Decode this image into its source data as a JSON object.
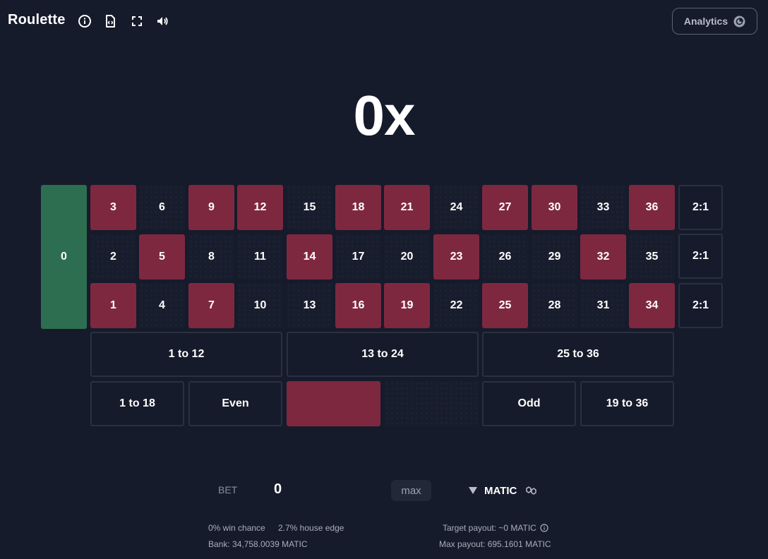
{
  "header": {
    "title": "Roulette",
    "analytics_label": "Analytics"
  },
  "colors": {
    "background": "#161b2b",
    "red": "#7e2840",
    "black": "#181d2d",
    "green": "#2d6e50"
  },
  "multiplier": "0x",
  "board": {
    "zero": "0",
    "rows": [
      [
        {
          "n": "3",
          "c": "red"
        },
        {
          "n": "6",
          "c": "black"
        },
        {
          "n": "9",
          "c": "red"
        },
        {
          "n": "12",
          "c": "red"
        },
        {
          "n": "15",
          "c": "black"
        },
        {
          "n": "18",
          "c": "red"
        },
        {
          "n": "21",
          "c": "red"
        },
        {
          "n": "24",
          "c": "black"
        },
        {
          "n": "27",
          "c": "red"
        },
        {
          "n": "30",
          "c": "red"
        },
        {
          "n": "33",
          "c": "black"
        },
        {
          "n": "36",
          "c": "red"
        }
      ],
      [
        {
          "n": "2",
          "c": "black"
        },
        {
          "n": "5",
          "c": "red"
        },
        {
          "n": "8",
          "c": "black"
        },
        {
          "n": "11",
          "c": "black"
        },
        {
          "n": "14",
          "c": "red"
        },
        {
          "n": "17",
          "c": "black"
        },
        {
          "n": "20",
          "c": "black"
        },
        {
          "n": "23",
          "c": "red"
        },
        {
          "n": "26",
          "c": "black"
        },
        {
          "n": "29",
          "c": "black"
        },
        {
          "n": "32",
          "c": "red"
        },
        {
          "n": "35",
          "c": "black"
        }
      ],
      [
        {
          "n": "1",
          "c": "red"
        },
        {
          "n": "4",
          "c": "black"
        },
        {
          "n": "7",
          "c": "red"
        },
        {
          "n": "10",
          "c": "black"
        },
        {
          "n": "13",
          "c": "black"
        },
        {
          "n": "16",
          "c": "red"
        },
        {
          "n": "19",
          "c": "red"
        },
        {
          "n": "22",
          "c": "black"
        },
        {
          "n": "25",
          "c": "red"
        },
        {
          "n": "28",
          "c": "black"
        },
        {
          "n": "31",
          "c": "black"
        },
        {
          "n": "34",
          "c": "red"
        }
      ]
    ],
    "columns": [
      "2:1",
      "2:1",
      "2:1"
    ],
    "dozens": [
      "1 to 12",
      "13 to 24",
      "25 to 36"
    ],
    "outside": {
      "low": "1 to 18",
      "even": "Even",
      "odd": "Odd",
      "high": "19 to 36"
    }
  },
  "bet": {
    "label": "BET",
    "value": "0",
    "max_label": "max",
    "currency": "MATIC"
  },
  "stats": {
    "win_chance": "0% win chance",
    "house_edge": "2.7% house edge",
    "bank": "Bank: 34,758.0039 MATIC",
    "target_payout": "Target payout: ~0 MATIC",
    "max_payout": "Max payout: 695.1601 MATIC"
  }
}
